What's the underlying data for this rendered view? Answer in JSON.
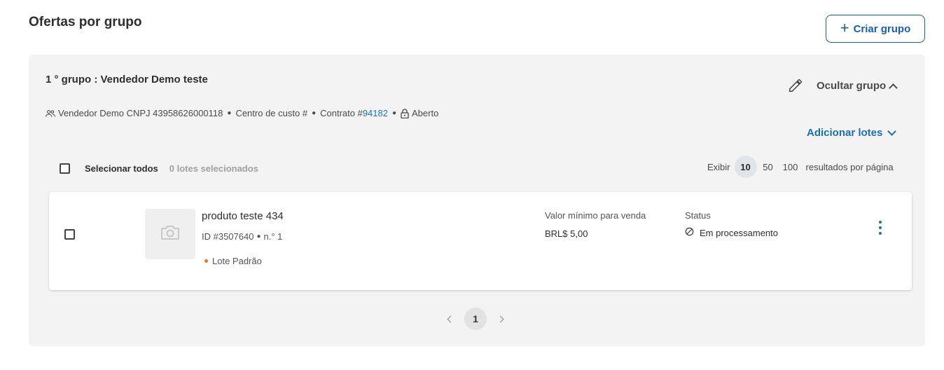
{
  "header": {
    "title": "Ofertas por grupo",
    "create_button": "Criar grupo"
  },
  "group": {
    "title": "1 ° grupo : Vendedor Demo teste",
    "hide_label": "Ocultar grupo",
    "meta": {
      "seller": "Vendedor Demo CNPJ 43958626000118",
      "cost_center": "Centro de custo #",
      "contract_prefix": "Contrato #",
      "contract_number": "94182",
      "status": "Aberto"
    },
    "add_lots": "Adicionar lotes",
    "select_all": "Selecionar todos",
    "selected_count": "0 lotes selecionados",
    "page_size": {
      "label": "Exibir",
      "options": [
        "10",
        "50",
        "100"
      ],
      "selected": "10",
      "suffix": "resultados por página"
    },
    "lot": {
      "name": "produto teste 434",
      "id": "ID #3507640",
      "number": "n.° 1",
      "type": "Lote Padrão",
      "min_label": "Valor mínimo para venda",
      "min_value": "BRL$ 5,00",
      "status_label": "Status",
      "status_value": "Em processamento"
    },
    "pagination": {
      "current": "1"
    }
  },
  "colors": {
    "primary": "#1a5fa8",
    "link": "#1a73c8",
    "accent_dot": "#e87722",
    "panel_bg": "#f3f3f3"
  }
}
